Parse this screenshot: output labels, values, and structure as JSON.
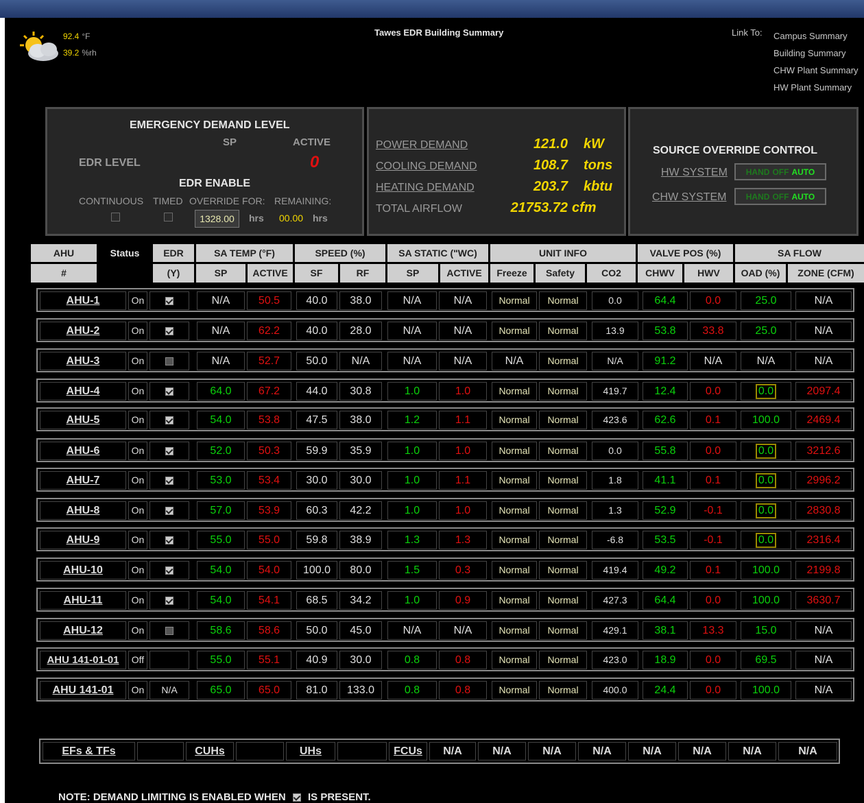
{
  "weather": {
    "temp": "92.4",
    "temp_unit": "°F",
    "rh": "39.2",
    "rh_unit": "%rh",
    "icon": "partly-sunny-icon"
  },
  "title": "Tawes EDR Building Summary",
  "links": {
    "label": "Link To:",
    "items": [
      "Campus Summary",
      "Building Summary",
      "CHW Plant Summary",
      "HW Plant Summary"
    ]
  },
  "edr": {
    "title": "EMERGENCY DEMAND LEVEL",
    "sp_label": "SP",
    "active_label": "ACTIVE",
    "level_label": "EDR LEVEL",
    "level_value": "0",
    "enable_title": "EDR ENABLE",
    "continuous": "CONTINUOUS",
    "timed": "TIMED",
    "override_for": "OVERRIDE FOR:",
    "remaining": "REMAINING:",
    "override_value": "1328.00",
    "hrs": "hrs",
    "remaining_value": "00.00"
  },
  "demand": [
    {
      "label": "POWER DEMAND",
      "value": "121.0",
      "unit": "kW"
    },
    {
      "label": "COOLING DEMAND",
      "value": "108.7",
      "unit": "tons"
    },
    {
      "label": "HEATING DEMAND",
      "value": "203.7",
      "unit": "kbtu"
    },
    {
      "label": "TOTAL AIRFLOW",
      "value": "21753.72",
      "unit": "cfm"
    }
  ],
  "source": {
    "title": "SOURCE OVERRIDE CONTROL",
    "systems": [
      {
        "label": "HW SYSTEM",
        "hand": "HAND",
        "off": "OFF",
        "auto": "AUTO"
      },
      {
        "label": "CHW SYSTEM",
        "hand": "HAND",
        "off": "OFF",
        "auto": "AUTO"
      }
    ]
  },
  "table": {
    "group_headers": [
      "AHU",
      "Status",
      "EDR",
      "SA TEMP (°F)",
      "SPEED (%)",
      "SA STATIC (\"WC)",
      "UNIT INFO",
      "VALVE POS (%)",
      "SA FLOW"
    ],
    "sub_headers": [
      "#",
      "(Y)",
      "SP",
      "ACTIVE",
      "SF",
      "RF",
      "SP",
      "ACTIVE",
      "Freeze",
      "Safety",
      "CO2",
      "CHWV",
      "HWV",
      "OAD (%)",
      "ZONE (CFM)"
    ],
    "rows": [
      {
        "name": "AHU-1",
        "status": "On",
        "edr": "check",
        "sat_sp": "N/A",
        "sat_act": "50.5",
        "sf": "40.0",
        "rf": "38.0",
        "st_sp": "N/A",
        "st_act": "N/A",
        "freeze": "Normal",
        "safety": "Normal",
        "co2": "0.0",
        "chwv": "64.4",
        "hwv": "0.0",
        "oad": "25.0",
        "zone": "N/A"
      },
      {
        "name": "AHU-2",
        "status": "On",
        "edr": "check",
        "sat_sp": "N/A",
        "sat_act": "62.2",
        "sf": "40.0",
        "rf": "28.0",
        "st_sp": "N/A",
        "st_act": "N/A",
        "freeze": "Normal",
        "safety": "Normal",
        "co2": "13.9",
        "chwv": "53.8",
        "hwv": "33.8",
        "oad": "25.0",
        "zone": "N/A"
      },
      {
        "name": "AHU-3",
        "status": "On",
        "edr": "empty",
        "sat_sp": "N/A",
        "sat_act": "52.7",
        "sf": "50.0",
        "rf": "N/A",
        "st_sp": "N/A",
        "st_act": "N/A",
        "freeze": "N/A",
        "safety": "Normal",
        "co2": "N/A",
        "chwv": "91.2",
        "hwv": "N/A",
        "oad": "N/A",
        "zone": "N/A"
      },
      {
        "name": "AHU-4",
        "status": "On",
        "edr": "check",
        "sat_sp": "64.0",
        "sat_act": "67.2",
        "sf": "44.0",
        "rf": "30.8",
        "st_sp": "1.0",
        "st_act": "1.0",
        "freeze": "Normal",
        "safety": "Normal",
        "co2": "419.7",
        "chwv": "12.4",
        "hwv": "0.0",
        "oad": "0.0",
        "zone": "2097.4"
      },
      {
        "name": "AHU-5",
        "status": "On",
        "edr": "check",
        "sat_sp": "54.0",
        "sat_act": "53.8",
        "sf": "47.5",
        "rf": "38.0",
        "st_sp": "1.2",
        "st_act": "1.1",
        "freeze": "Normal",
        "safety": "Normal",
        "co2": "423.6",
        "chwv": "62.6",
        "hwv": "0.1",
        "oad": "100.0",
        "zone": "2469.4"
      },
      {
        "name": "AHU-6",
        "status": "On",
        "edr": "check",
        "sat_sp": "52.0",
        "sat_act": "50.3",
        "sf": "59.9",
        "rf": "35.9",
        "st_sp": "1.0",
        "st_act": "1.0",
        "freeze": "Normal",
        "safety": "Normal",
        "co2": "0.0",
        "chwv": "55.8",
        "hwv": "0.0",
        "oad": "0.0",
        "zone": "3212.6"
      },
      {
        "name": "AHU-7",
        "status": "On",
        "edr": "check",
        "sat_sp": "53.0",
        "sat_act": "53.4",
        "sf": "30.0",
        "rf": "30.0",
        "st_sp": "1.0",
        "st_act": "1.1",
        "freeze": "Normal",
        "safety": "Normal",
        "co2": "1.8",
        "chwv": "41.1",
        "hwv": "0.1",
        "oad": "0.0",
        "zone": "2996.2"
      },
      {
        "name": "AHU-8",
        "status": "On",
        "edr": "check",
        "sat_sp": "57.0",
        "sat_act": "53.9",
        "sf": "60.3",
        "rf": "42.2",
        "st_sp": "1.0",
        "st_act": "1.0",
        "freeze": "Normal",
        "safety": "Normal",
        "co2": "1.3",
        "chwv": "52.9",
        "hwv": "-0.1",
        "oad": "0.0",
        "zone": "2830.8"
      },
      {
        "name": "AHU-9",
        "status": "On",
        "edr": "check",
        "sat_sp": "55.0",
        "sat_act": "55.0",
        "sf": "59.8",
        "rf": "38.9",
        "st_sp": "1.3",
        "st_act": "1.3",
        "freeze": "Normal",
        "safety": "Normal",
        "co2": "-6.8",
        "chwv": "53.5",
        "hwv": "-0.1",
        "oad": "0.0",
        "zone": "2316.4"
      },
      {
        "name": "AHU-10",
        "status": "On",
        "edr": "check",
        "sat_sp": "54.0",
        "sat_act": "54.0",
        "sf": "100.0",
        "rf": "80.0",
        "st_sp": "1.5",
        "st_act": "0.3",
        "freeze": "Normal",
        "safety": "Normal",
        "co2": "419.4",
        "chwv": "49.2",
        "hwv": "0.1",
        "oad": "100.0",
        "zone": "2199.8"
      },
      {
        "name": "AHU-11",
        "status": "On",
        "edr": "check",
        "sat_sp": "54.0",
        "sat_act": "54.1",
        "sf": "68.5",
        "rf": "34.2",
        "st_sp": "1.0",
        "st_act": "0.9",
        "freeze": "Normal",
        "safety": "Normal",
        "co2": "427.3",
        "chwv": "64.4",
        "hwv": "0.0",
        "oad": "100.0",
        "zone": "3630.7"
      },
      {
        "name": "AHU-12",
        "status": "On",
        "edr": "empty",
        "sat_sp": "58.6",
        "sat_act": "58.6",
        "sf": "50.0",
        "rf": "45.0",
        "st_sp": "N/A",
        "st_act": "N/A",
        "freeze": "Normal",
        "safety": "Normal",
        "co2": "429.1",
        "chwv": "38.1",
        "hwv": "13.3",
        "oad": "15.0",
        "zone": "N/A"
      },
      {
        "name": "AHU 141-01-01",
        "status": "Off",
        "edr": "",
        "sat_sp": "55.0",
        "sat_act": "55.1",
        "sf": "40.9",
        "rf": "30.0",
        "st_sp": "0.8",
        "st_act": "0.8",
        "freeze": "Normal",
        "safety": "Normal",
        "co2": "423.0",
        "chwv": "18.9",
        "hwv": "0.0",
        "oad": "69.5",
        "zone": "N/A"
      },
      {
        "name": "AHU 141-01",
        "status": "On",
        "edr": "N/A",
        "sat_sp": "65.0",
        "sat_act": "65.0",
        "sf": "81.0",
        "rf": "133.0",
        "st_sp": "0.8",
        "st_act": "0.8",
        "freeze": "Normal",
        "safety": "Normal",
        "co2": "400.0",
        "chwv": "24.4",
        "hwv": "0.0",
        "oad": "100.0",
        "zone": "N/A"
      }
    ]
  },
  "bottom": {
    "links": [
      "EFs & TFs",
      "CUHs",
      "UHs",
      "FCUs"
    ],
    "na": "N/A"
  },
  "note": {
    "before": "NOTE: DEMAND LIMITING IS ENABLED WHEN",
    "after": "IS PRESENT."
  },
  "colors": {
    "green": "#0bd10b",
    "red": "#e01010",
    "yellow": "#f2d600",
    "background": "#000000"
  }
}
